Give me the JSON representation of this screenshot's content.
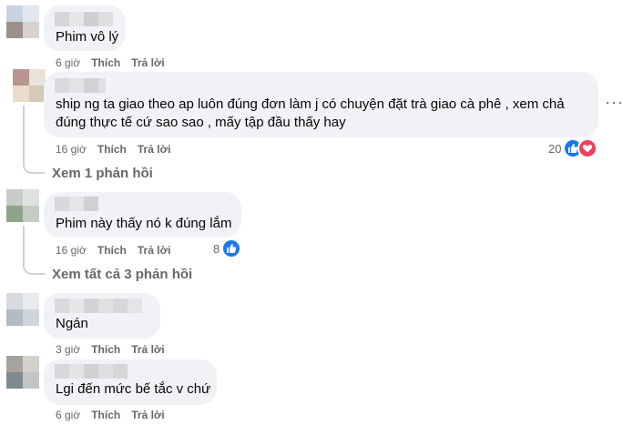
{
  "comments": [
    {
      "text": "Phim vô lý",
      "time": "6 giờ",
      "like_label": "Thích",
      "reply_label": "Trả lời"
    },
    {
      "text_line1": "ship ng ta giao theo ap luôn đúng đơn làm j có chuyện đặt trà giao cà phê , xem chả",
      "text_line2": "đúng thực tế cứ sao sao , mấy tập đầu thấy hay",
      "time": "16 giờ",
      "like_label": "Thích",
      "reply_label": "Trả lời",
      "reaction_count": "20",
      "replies_link": "Xem 1 phản hồi"
    },
    {
      "text": "Phim này thấy nó k đúng lắm",
      "time": "16 giờ",
      "like_label": "Thích",
      "reply_label": "Trả lời",
      "reaction_count": "8",
      "replies_link": "Xem tất cả 3 phản hồi"
    },
    {
      "text": "Ngán",
      "time": "3 giờ",
      "like_label": "Thích",
      "reply_label": "Trả lời"
    },
    {
      "text": "Lgi đến mức bế tắc v chứ",
      "time": "6 giờ",
      "like_label": "Thích",
      "reply_label": "Trả lời"
    }
  ],
  "more_options_glyph": "···",
  "colors": {
    "bubble": "#f0f2f5",
    "meta": "#65676b",
    "like": "#1877f2",
    "love": "#f33e58"
  }
}
